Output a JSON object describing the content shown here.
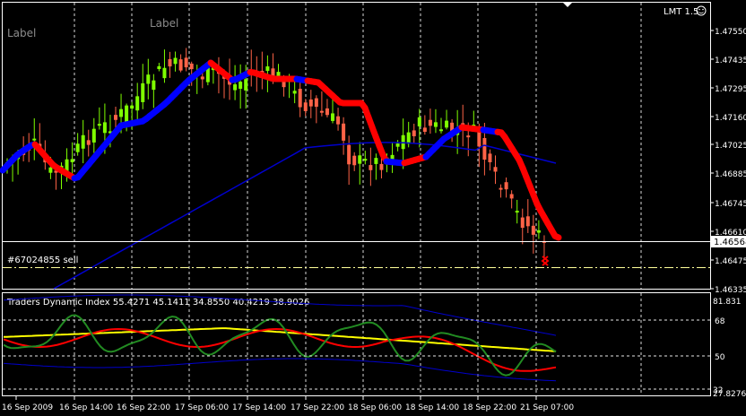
{
  "watermark_labels": [
    "Label",
    "Label"
  ],
  "top_right": {
    "text": "LMT 1.5",
    "icon": "smiley-icon"
  },
  "price_axis": {
    "ticks": [
      "1.47550",
      "1.47435",
      "1.47295",
      "1.47160",
      "1.47025",
      "1.46885",
      "1.46745",
      "1.46610",
      "1.46475",
      "1.46335"
    ],
    "current_price": "1.46568"
  },
  "order_line": {
    "label": "#67024855 sell"
  },
  "indicator": {
    "title": "Traders Dynamic Index 55.4271 45.1411 34.8550 40.4219 38.9026",
    "levels": [
      "81.831",
      "68",
      "50",
      "32",
      "27.8276"
    ]
  },
  "time_axis": {
    "labels": [
      "16 Sep 2009",
      "16 Sep 14:00",
      "16 Sep 22:00",
      "17 Sep 06:00",
      "17 Sep 14:00",
      "17 Sep 22:00",
      "18 Sep 06:00",
      "18 Sep 14:00",
      "18 Sep 22:00",
      "21 Sep 07:00"
    ]
  },
  "colors": {
    "background": "#000000",
    "bull_candle": "#7fff00",
    "bear_candle": "#ff6347",
    "ma_up": "#0000ff",
    "ma_down": "#ff0000",
    "slow_ma": "#0000cd",
    "grid": "#ffffff",
    "order_line": "#ffff99",
    "tdi_green": "#228b22",
    "tdi_red": "#ff0000",
    "tdi_yellow": "#ffff00",
    "tdi_band": "#0000cd"
  }
}
